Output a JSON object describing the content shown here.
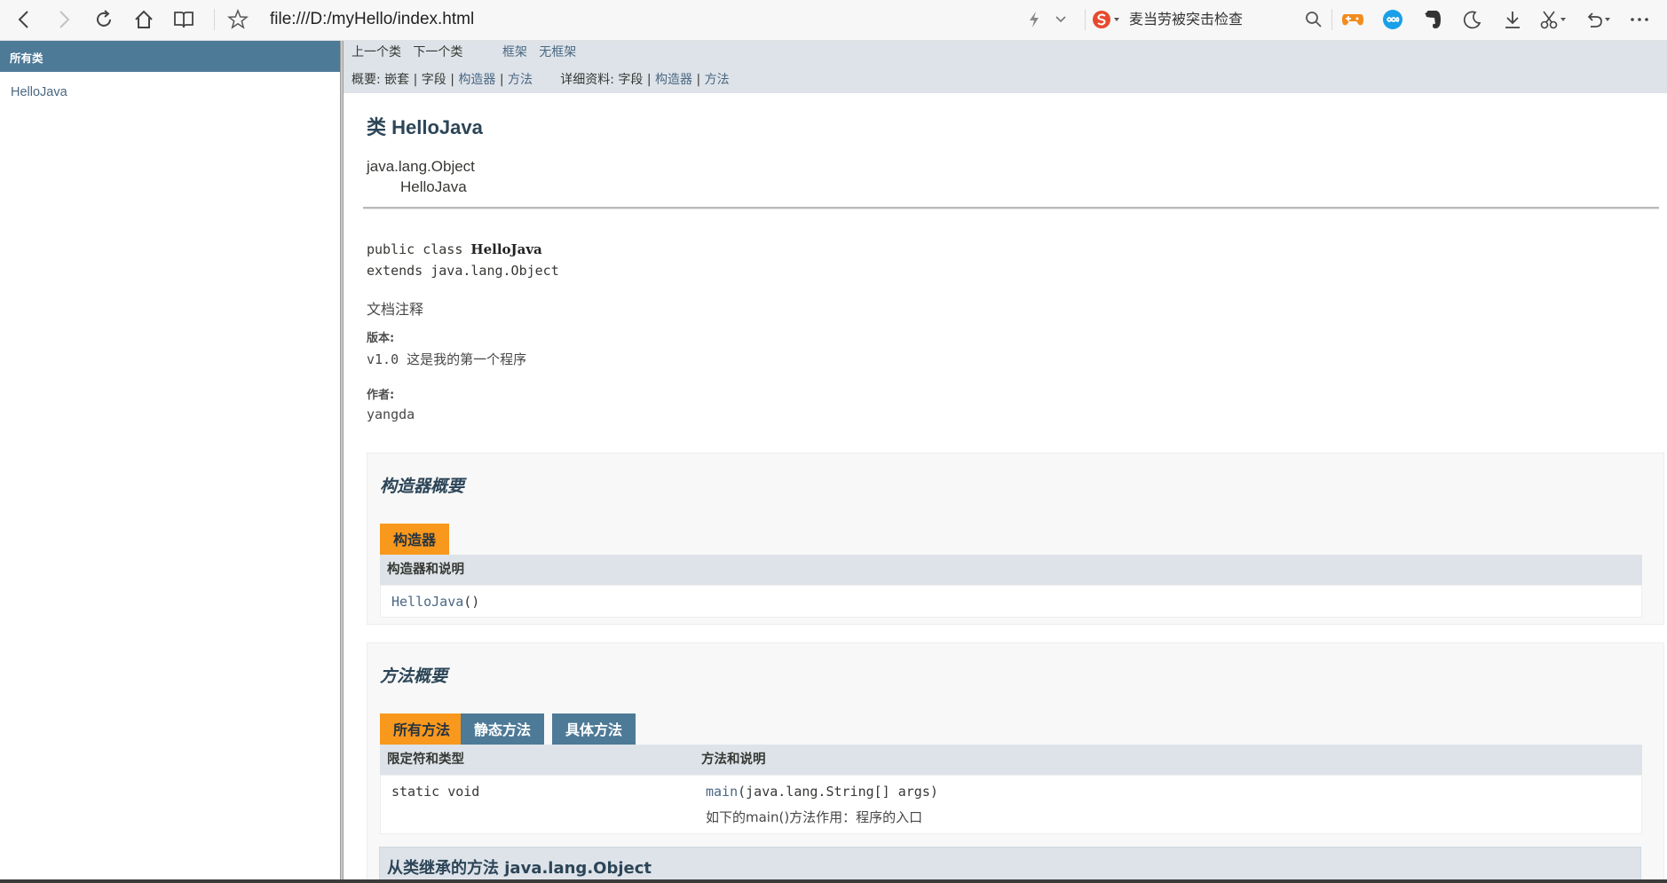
{
  "browser": {
    "url": "file:///D:/myHello/index.html",
    "search_text": "麦当劳被突击检查",
    "icons": [
      "back-icon",
      "forward-icon",
      "reload-icon",
      "home-icon",
      "reading-icon",
      "star-icon",
      "lightning-icon",
      "chevron-down-icon",
      "sogou-search-icon",
      "search-icon",
      "game-icon",
      "link-icon",
      "evernote-icon",
      "moon-icon",
      "download-icon",
      "scissors-icon",
      "undo-icon",
      "more-icon"
    ]
  },
  "left_frame": {
    "header": "所有类",
    "classes": [
      "HelloJava"
    ]
  },
  "topnav": {
    "prev_class": "上一个类",
    "next_class": "下一个类",
    "frames": "框架",
    "no_frames": "无框架",
    "summary_label": "概要: ",
    "summary_nested": "嵌套",
    "summary_field": "字段",
    "summary_constructor": "构造器",
    "summary_method": "方法",
    "detail_label": "详细资料: ",
    "detail_field": "字段",
    "detail_constructor": "构造器",
    "detail_method": "方法",
    "sep": " | "
  },
  "class_doc": {
    "title": "类 HelloJava",
    "inheritance": [
      "java.lang.Object",
      "HelloJava"
    ],
    "sig_public_class": "public class ",
    "sig_name": "HelloJava",
    "sig_extends": "extends java.lang.Object",
    "comment": "文档注释",
    "version_label": "版本:",
    "version_value": "v1.0 这是我的第一个程序",
    "author_label": "作者:",
    "author_value": "yangda"
  },
  "constructor_summary": {
    "heading": "构造器概要",
    "tab": "构造器",
    "column": "构造器和说明",
    "rows": [
      {
        "name": "HelloJava",
        "params": "()"
      }
    ]
  },
  "method_summary": {
    "heading": "方法概要",
    "tabs": [
      "所有方法",
      "静态方法",
      "具体方法"
    ],
    "columns": [
      "限定符和类型",
      "方法和说明"
    ],
    "rows": [
      {
        "modifier": "static void",
        "name": "main",
        "params": "(java.lang.String[]  args)",
        "description": "如下的main()方法作用：程序的入口"
      }
    ]
  },
  "inherited": {
    "label": "从类继承的方法 java.lang.Object"
  },
  "colors": {
    "nav_blue": "#4d7a97",
    "nav_light": "#dee3e9",
    "tab_orange": "#f8981d",
    "link": "#4a6782"
  }
}
